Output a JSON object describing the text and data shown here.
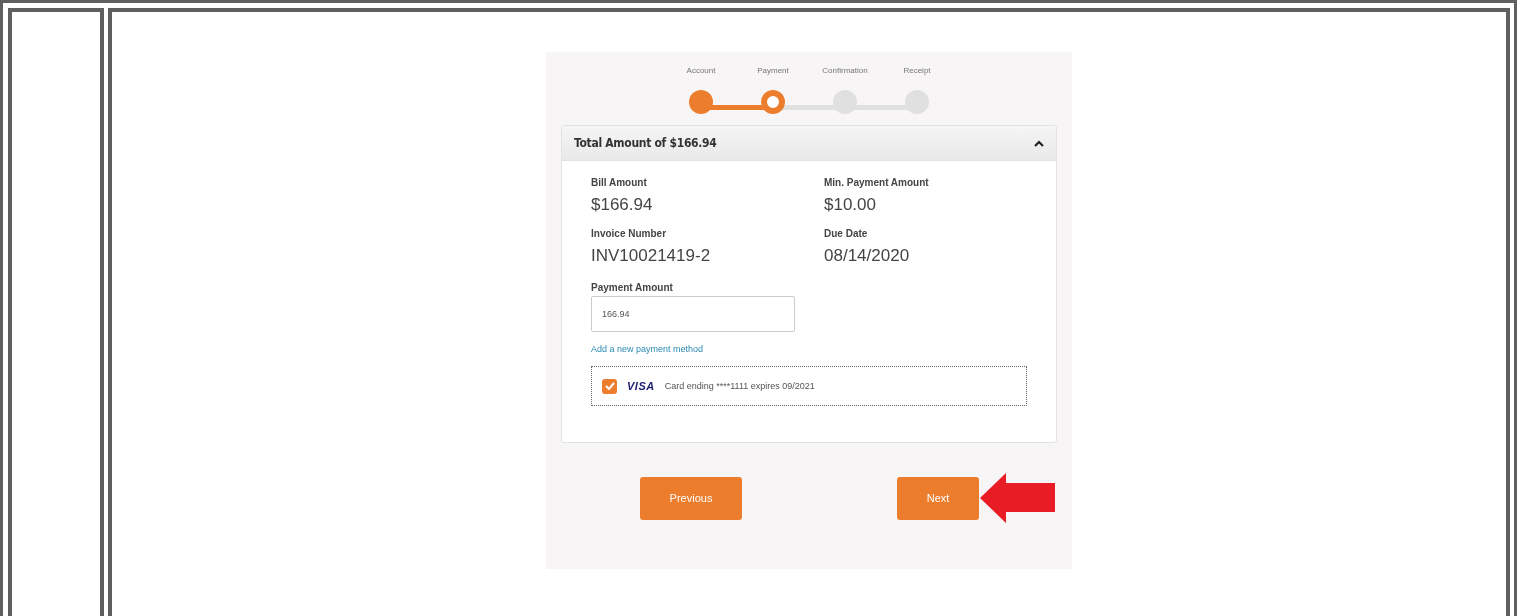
{
  "steps": [
    {
      "label": "Account",
      "completed": true,
      "selected": false
    },
    {
      "label": "Payment",
      "completed": false,
      "selected": true
    },
    {
      "label": "Confirmation",
      "completed": false,
      "selected": false
    },
    {
      "label": "Receipt",
      "completed": false,
      "selected": false
    }
  ],
  "summary": {
    "title": "Total Amount of $166.94",
    "expanded": true,
    "fields": [
      {
        "label": "Bill Amount",
        "value": "$166.94"
      },
      {
        "label": "Min. Payment Amount",
        "value": "$10.00"
      },
      {
        "label": "Invoice Number",
        "value": "INV10021419-2"
      },
      {
        "label": "Due Date",
        "value": "08/14/2020"
      }
    ],
    "payment_amount": {
      "label": "Payment Amount",
      "value": "166.94"
    },
    "add_method_link": "Add a new payment method",
    "card": {
      "checked": true,
      "brand": "VISA",
      "text": "Card ending ****1111 expires 09/2021"
    }
  },
  "buttons": [
    {
      "label": "Previous"
    },
    {
      "label": "Next",
      "highlighted": true
    }
  ]
}
